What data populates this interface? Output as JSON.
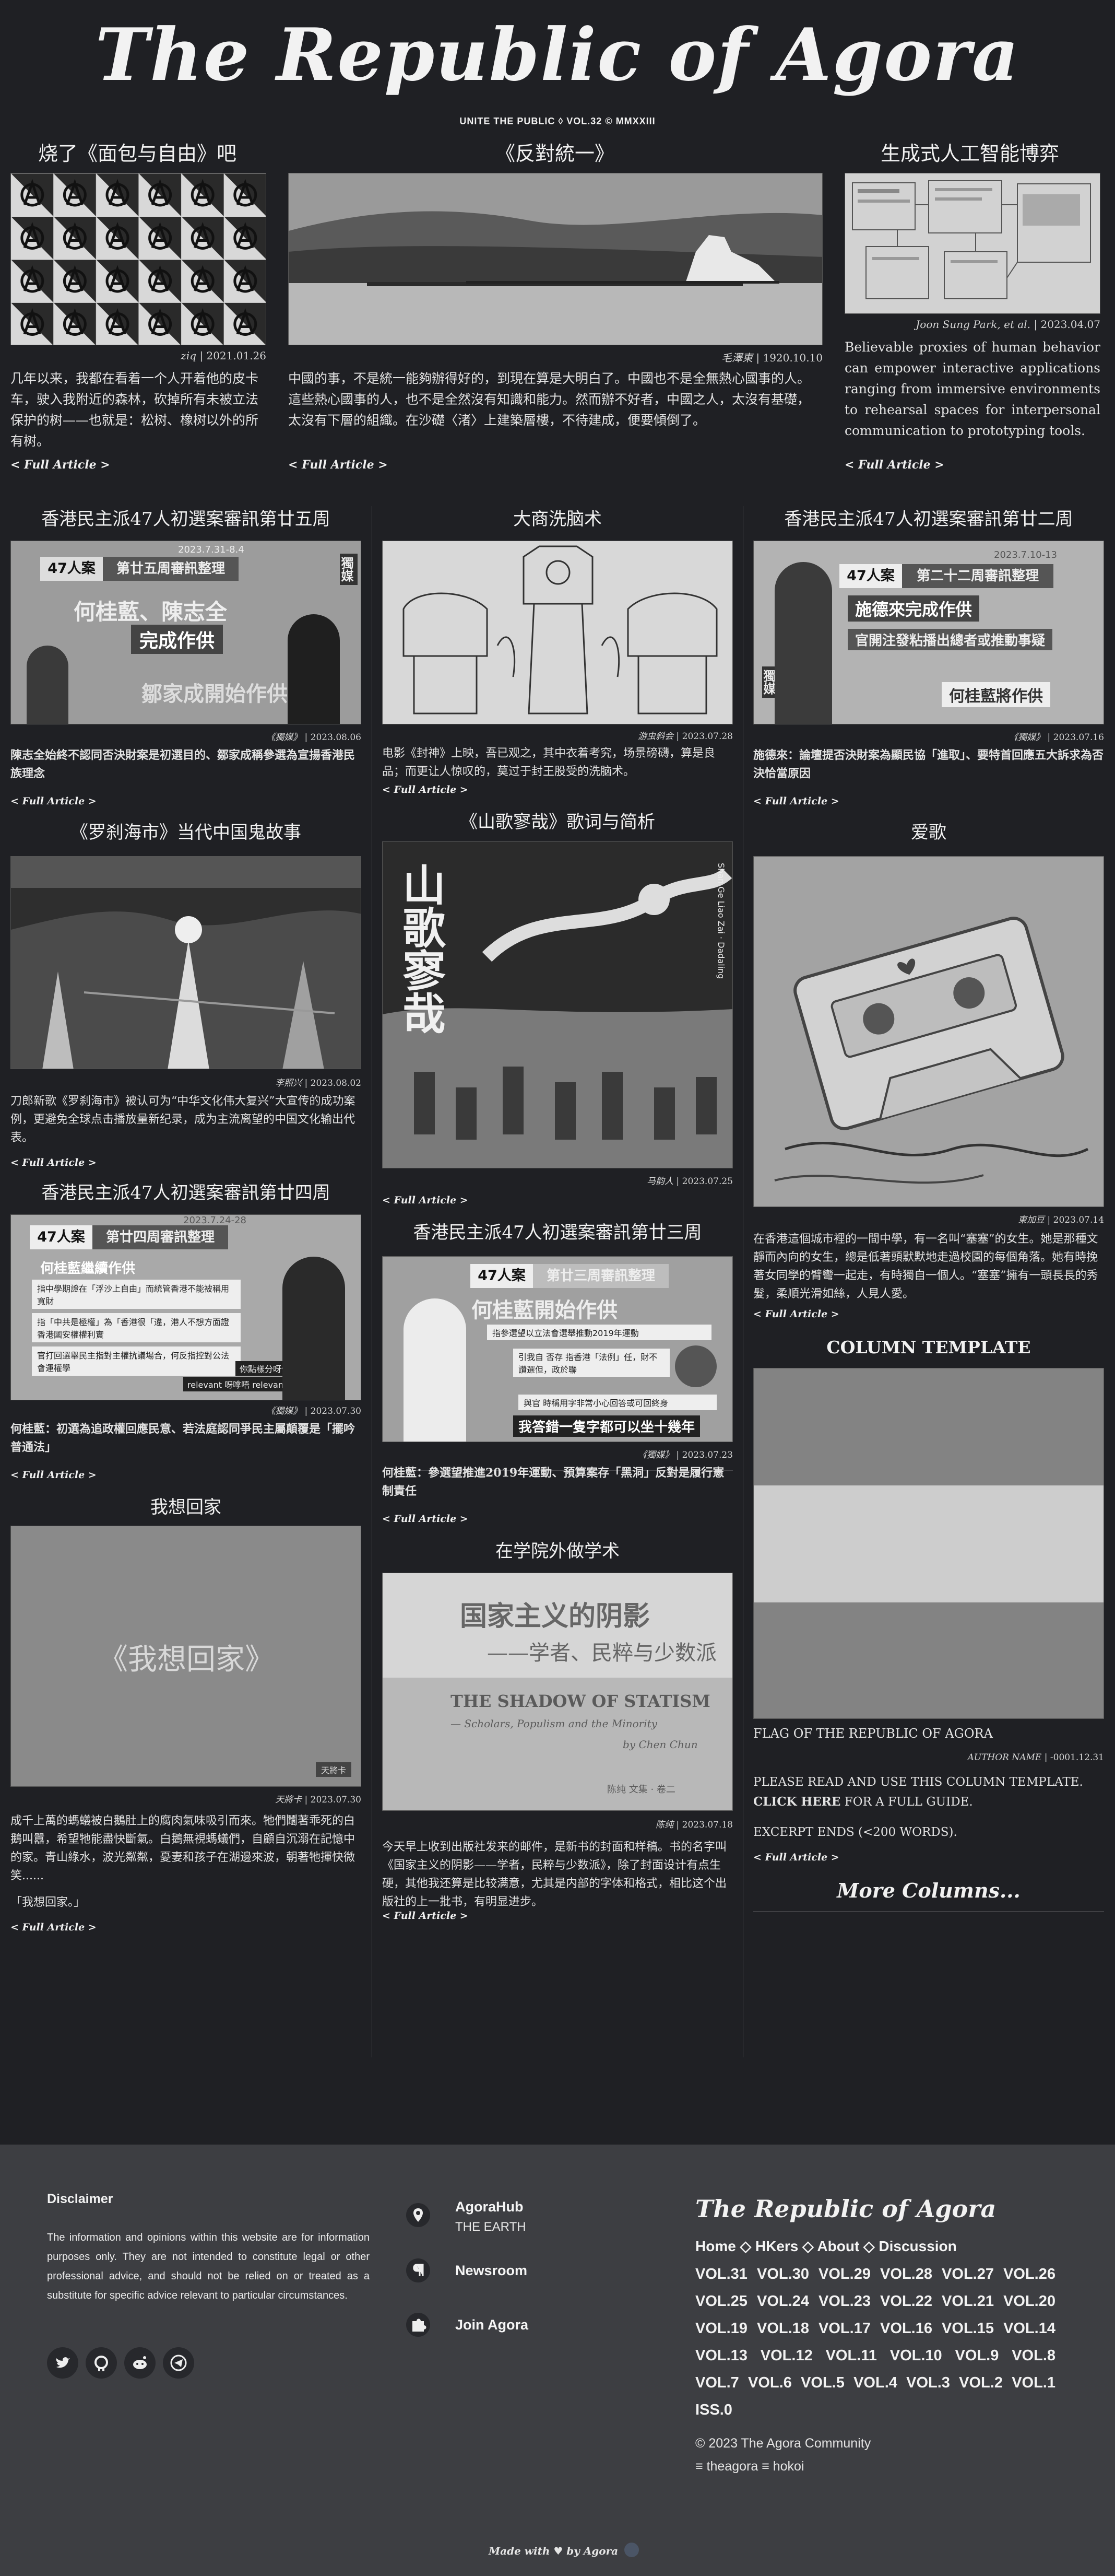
{
  "masthead": {
    "title": "The Republic of Agora",
    "tagline": "UNITE THE PUBLIC ◊ VOL.32 © MMXXIII"
  },
  "articles": {
    "bread": {
      "title": "烧了《面包与自由》吧",
      "credit_author": "ziq",
      "credit_date": "2021.01.26",
      "excerpt": "几年以来，我都在看着一个人开着他的皮卡车，驶入我附近的森林，砍掉所有未被立法保护的树——也就是：松树、橡树以外的所有树。",
      "link": "< Full Article >"
    },
    "antiunify": {
      "title": "《反對統一》",
      "credit_author": "毛澤東",
      "credit_date": "1920.10.10",
      "excerpt": "中國的事，不是統一能夠辦得好的，到現在算是大明白了。中國也不是全無熱心國事的人。這些熱心國事的人，也不是全然沒有知識和能力。然而辦不好者，中國之人，太沒有基礎，太沒有下層的組織。在沙礎〈渚〉上建築層樓，不待建成，便要傾倒了。",
      "link": "< Full Article >"
    },
    "genai": {
      "title": "生成式人工智能博弈",
      "credit_author": "Joon Sung Park, et al.",
      "credit_date": "2023.04.07",
      "excerpt": "Believable proxies of human behavior can empower interactive applications ranging from immersive environments to rehearsal spaces for interpersonal communication to prototyping tools.",
      "link": "< Full Article >"
    },
    "hk25": {
      "title": "香港民主派47人初選案審訊第廿五周",
      "credit_author": "《獨媒》",
      "credit_date": "2023.08.06",
      "excerpt": "陳志全始終不認同否決財案是初選目的、鄒家成稱參選為宣揚香港民族理念",
      "link": "< Full Article >",
      "img_badge": "47人案",
      "img_banner": "第廿五周審訊整理",
      "img_line1": "何桂藍、陳志全",
      "img_line2": "完成作供",
      "img_line3": "鄒家成開始作供",
      "img_date": "2023.7.31-8.4",
      "img_side": "獨媒"
    },
    "brainwash": {
      "title": "大商洗脑术",
      "credit_author": "游虫斜会",
      "credit_date": "2023.07.28",
      "excerpt": "电影《封神》上映，吾已观之，其中衣着考究，场景磅礴，算是良品；而更让人惊叹的，莫过于封王股受的洗脑术。",
      "link": "< Full Article >"
    },
    "hk22": {
      "title": "香港民主派47人初選案審訊第廿二周",
      "credit_author": "《獨媒》",
      "credit_date": "2023.07.16",
      "excerpt": "施德來：論壇提否決財案為顯民協「進取」、要特首回應五大訴求為否決恰當原因",
      "link": "< Full Article >",
      "img_badge": "47人案",
      "img_banner": "第二十二周審訊整理",
      "img_line1": "施德來完成作供",
      "img_line2": "官開注發粘播出總者或推動事疑",
      "img_line3": "何桂藍將作供",
      "img_date": "2023.7.10-13",
      "img_side": "獨媒"
    },
    "rakshasa": {
      "title": "《罗刹海市》当代中国鬼故事",
      "credit_author": "李照兴",
      "credit_date": "2023.08.02",
      "excerpt": "刀郎新歌《罗刹海市》被认可为“中华文化伟大复兴”大宣传的成功案例，更避免全球点击播放量新纪录，成为主流离望的中国文化输出代表。",
      "link": "< Full Article >"
    },
    "mountainsong": {
      "title": "《山歌寥哉》歌词与简析",
      "credit_author": "马韵人",
      "credit_date": "2023.07.25",
      "link": "< Full Article >",
      "img_title": "山歌寥哉",
      "img_side": "Shan Ge Liao Zai · Dadaling"
    },
    "lovesong": {
      "title": "爱歌",
      "credit_author": "東加豆",
      "credit_date": "2023.07.14",
      "excerpt": "在香港這個城市裡的一間中學，有一名叫“塞塞”的女生。她是那種文靜而內向的女生，總是低著頭默默地走過校園的每個角落。她有時挽著女同學的臂彎一起走，有時獨自一個人。“塞塞”擁有一頭長長的秀髮，柔順光滑如絲，人見人愛。",
      "link": "< Full Article >"
    },
    "hk24": {
      "title": "香港民主派47人初選案審訊第廿四周",
      "credit_author": "《獨媒》",
      "credit_date": "2023.07.30",
      "excerpt": "何桂藍：初選為追政權回應民意、若法庭認同爭民主屬顛覆是「擺吟普通法」",
      "link": "< Full Article >",
      "img_badge": "47人案",
      "img_banner": "第廿四周審訊整理",
      "img_line1": "何桂藍繼續作供",
      "img_bullet1": "指中學期證在「浮沙上自由」而統管香港不能被稱用寬財",
      "img_bullet2": "指「中共是極權」為「香港很「違，港人不想方面證香港國安權權利實",
      "img_bullet3": "官打回選舉民主指對主權抗議場合，何反指控對公法會運權學",
      "img_tag": "relevant 呀嗱唔 relevant？",
      "img_tag2": "你點樣分呀係",
      "img_date": "2023.7.24-28"
    },
    "hk23": {
      "title": "香港民主派47人初選案審訊第廿三周",
      "credit_author": "《獨媒》",
      "credit_date": "2023.07.23",
      "excerpt": "何桂藍：參選望推進2019年運動、預算案存「黑洞」反對是履行憲制責任",
      "link": "< Full Article >",
      "img_badge": "47人案",
      "img_banner": "第廿三周審訊整理",
      "img_line1": "何桂藍開始作供",
      "img_bullet1": "指參選望以立法會選舉推動2019年運動",
      "img_bullet2": "引我自 否存 指香港「法例」任，財不讚選但，政於聯",
      "img_bullet3": "與官 時稱用字非常小心回答或可回終身",
      "img_caption": "我答錯一隻字都可以坐十幾年"
    },
    "gohome": {
      "title": "我想回家",
      "credit_author": "天將卡",
      "credit_date": "2023.07.30",
      "excerpt": "成千上萬的螞蟻被白鵝肚上的腐肉氣味吸引而來。牠們鬮著乖死的白鵝叫囂，希望牠能盡快斷氣。白鵝無視螞蟻們，自顧自沉溺在記憶中的家。青山綠水，波光粼粼，憂妻和孩子在湖邊來波，朝著牠揮快微笑......",
      "excerpt2": "「我想回家。」",
      "link": "< Full Article >",
      "img_text": "《我想回家》",
      "img_tag": "天將卡"
    },
    "statism": {
      "title": "在学院外做学术",
      "credit_author": "陈纯",
      "credit_date": "2023.07.18",
      "excerpt": "今天早上收到出版社发来的邮件，是新书的封面和样稿。书的名字叫《国家主义的阴影——学者，民粹与少数派》，除了封面设计有点生硬，其他我还算是比较满意，尤其是内部的字体和格式，相比这个出版社的上一批书，有明显进步。",
      "link": "< Full Article >",
      "img_cn_title": "国家主义的阴影",
      "img_cn_sub": "——学者、民粹与少数派",
      "img_en_title": "THE SHADOW OF STATISM",
      "img_en_sub": "— Scholars, Populism and the Minority",
      "img_author": "by Chen Chun",
      "img_cn_author": "陈纯 文集 · 卷二"
    },
    "template": {
      "title": "COLUMN TEMPLATE",
      "caption": "FLAG OF THE REPUBLIC OF AGORA",
      "credit_author": "AUTHOR NAME",
      "credit_date": "-0001.12.31",
      "excerpt_a": "PLEASE READ AND USE THIS COLUMN TEMPLATE.",
      "excerpt_click": "CLICK HERE",
      "excerpt_b": "FOR A FULL GUIDE.",
      "excerpt2": "EXCERPT ENDS (<200 WORDS).",
      "link": "< Full Article >"
    },
    "more": "More Columns..."
  },
  "footer": {
    "disclaimer_title": "Disclaimer",
    "disclaimer_text": "The information and opinions within this website are for information purposes only. They are not intended to constitute legal or other professional advice, and should not be relied on or treated as a substitute for specific advice relevant to particular circumstances.",
    "links": [
      {
        "label": "AgoraHub",
        "sub": "THE EARTH",
        "icon": "location-pin-icon"
      },
      {
        "label": "Newsroom",
        "sub": "",
        "icon": "paragraph-icon"
      },
      {
        "label": "Join Agora",
        "sub": "",
        "icon": "puzzle-icon"
      }
    ],
    "social": [
      "twitter-icon",
      "github-icon",
      "reddit-icon",
      "telegram-icon"
    ],
    "brand": "The Republic of Agora",
    "nav": "Home ◇ HKers ◇ About ◇ Discussion",
    "volumes": "VOL.31 VOL.30 VOL.29 VOL.28 VOL.27 VOL.26 VOL.25 VOL.24 VOL.23 VOL.22 VOL.21 VOL.20 VOL.19 VOL.18 VOL.17 VOL.16 VOL.15 VOL.14 VOL.13 VOL.12 VOL.11 VOL.10 VOL.9 VOL.8 VOL.7 VOL.6 VOL.5 VOL.4 VOL.3 VOL.2 VOL.1 ISS.0",
    "copyright": "© 2023 The Agora Community",
    "handles": "≡ theagora ≡ hokoi",
    "made_with": "Made with ♥ by Agora"
  },
  "colors": {
    "background": "#1f2024",
    "footer_bg": "#3d3e42",
    "text": "#e6e6e6",
    "divider": "#4a4a4e"
  }
}
